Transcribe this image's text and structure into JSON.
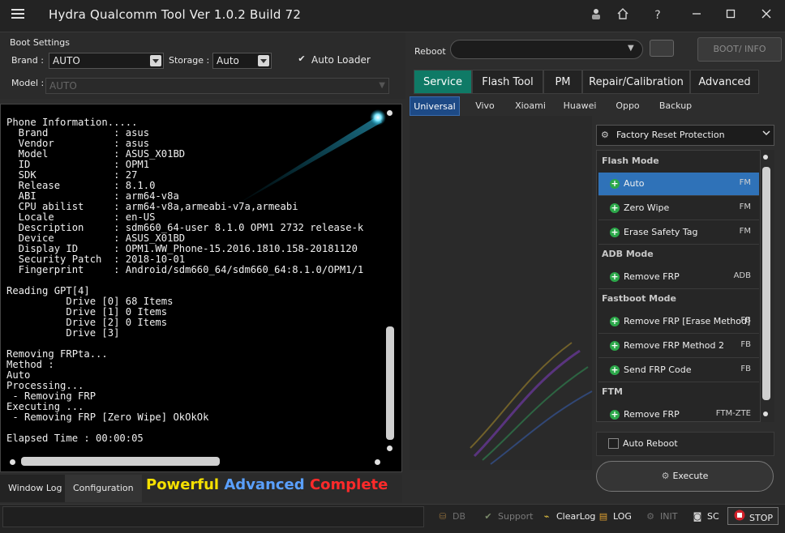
{
  "window": {
    "title": "Hydra Qualcomm  Tool  Ver 1.0.2 Build 72"
  },
  "boot_settings": {
    "title": "Boot Settings",
    "brand_label": "Brand :",
    "brand_value": "AUTO",
    "storage_label": "Storage :",
    "storage_value": "Auto",
    "auto_loader_label": "Auto Loader",
    "auto_loader_checked": true,
    "model_label": "Model :",
    "model_value": "AUTO"
  },
  "log": {
    "text": "Phone Information.....\n  Brand           : asus\n  Vendor          : asus\n  Model           : ASUS_X01BD\n  ID              : OPM1\n  SDK             : 27\n  Release         : 8.1.0\n  ABI             : arm64-v8a\n  CPU abilist     : arm64-v8a,armeabi-v7a,armeabi\n  Locale          : en-US\n  Description     : sdm660_64-user 8.1.0 OPM1 2732 release-k\n  Device          : ASUS_X01BD\n  Display ID      : OPM1.WW_Phone-15.2016.1810.158-20181120\n  Security Patch  : 2018-10-01\n  Fingerprint     : Android/sdm660_64/sdm660_64:8.1.0/OPM1/1\n\nReading GPT[4]\n          Drive [0] 68 Items\n          Drive [1] 0 Items\n          Drive [2] 0 Items\n          Drive [3]\n\nRemoving FRPta...\nMethod :\nAuto\nProcessing...\n - Removing FRP\nExecuting ...\n - Removing FRP [Zero Wipe] OkOkOk\n\nElapsed Time : 00:00:05"
  },
  "bottom_tabs": {
    "window_log": "Window Log",
    "configuration": "Configuration"
  },
  "slogan": {
    "word1": "Powerful",
    "word2": "Advanced",
    "word3": "Complete",
    "color1": "#f5e000",
    "color2": "#5aa0ff",
    "color3": "#ff2a2a"
  },
  "reboot": {
    "label": "Reboot",
    "value": "",
    "boot_info_label": "BOOT/ INFO"
  },
  "main_tabs": [
    {
      "label": "Service",
      "active": true
    },
    {
      "label": "Flash Tool",
      "active": false
    },
    {
      "label": "PM",
      "active": false
    },
    {
      "label": "Repair/Calibration",
      "active": false
    },
    {
      "label": "Advanced",
      "active": false
    }
  ],
  "sub_tabs": [
    {
      "label": "Universal",
      "active": true
    },
    {
      "label": "Vivo",
      "active": false
    },
    {
      "label": "Xioami",
      "active": false
    },
    {
      "label": "Huawei",
      "active": false
    },
    {
      "label": "Oppo",
      "active": false
    },
    {
      "label": "Backup",
      "active": false
    }
  ],
  "frp": {
    "selected": "Factory Reset Protection",
    "sections": [
      {
        "title": "Flash Mode"
      },
      {
        "title": "ADB Mode"
      },
      {
        "title": "Fastboot Mode"
      },
      {
        "title": "FTM"
      }
    ],
    "operations": [
      {
        "label": "Auto",
        "tag": "FM",
        "selected": true
      },
      {
        "label": "Zero Wipe",
        "tag": "FM",
        "selected": false
      },
      {
        "label": "Erase Safety Tag",
        "tag": "FM",
        "selected": false
      },
      {
        "label": "Remove FRP",
        "tag": "ADB",
        "selected": false
      },
      {
        "label": "Remove FRP [Erase Method]",
        "tag": "FB",
        "selected": false
      },
      {
        "label": "Remove FRP Method 2",
        "tag": "FB",
        "selected": false
      },
      {
        "label": "Send FRP Code",
        "tag": "FB",
        "selected": false
      },
      {
        "label": "Remove FRP",
        "tag": "FTM-ZTE",
        "selected": false
      }
    ],
    "auto_reboot_label": "Auto Reboot",
    "auto_reboot_checked": false,
    "execute_label": "Execute"
  },
  "statusbar": {
    "db": "DB",
    "support": "Support",
    "clearlog": "ClearLog",
    "log": "LOG",
    "init": "INIT",
    "sc": "SC",
    "stop": "STOP"
  },
  "colors": {
    "accent_tab": "#0f7a66",
    "selected_row": "#2f72b8",
    "sub_tab_active": "#1d4a86",
    "plus_icon": "#2ca84a",
    "stop_icon": "#d0202a"
  }
}
